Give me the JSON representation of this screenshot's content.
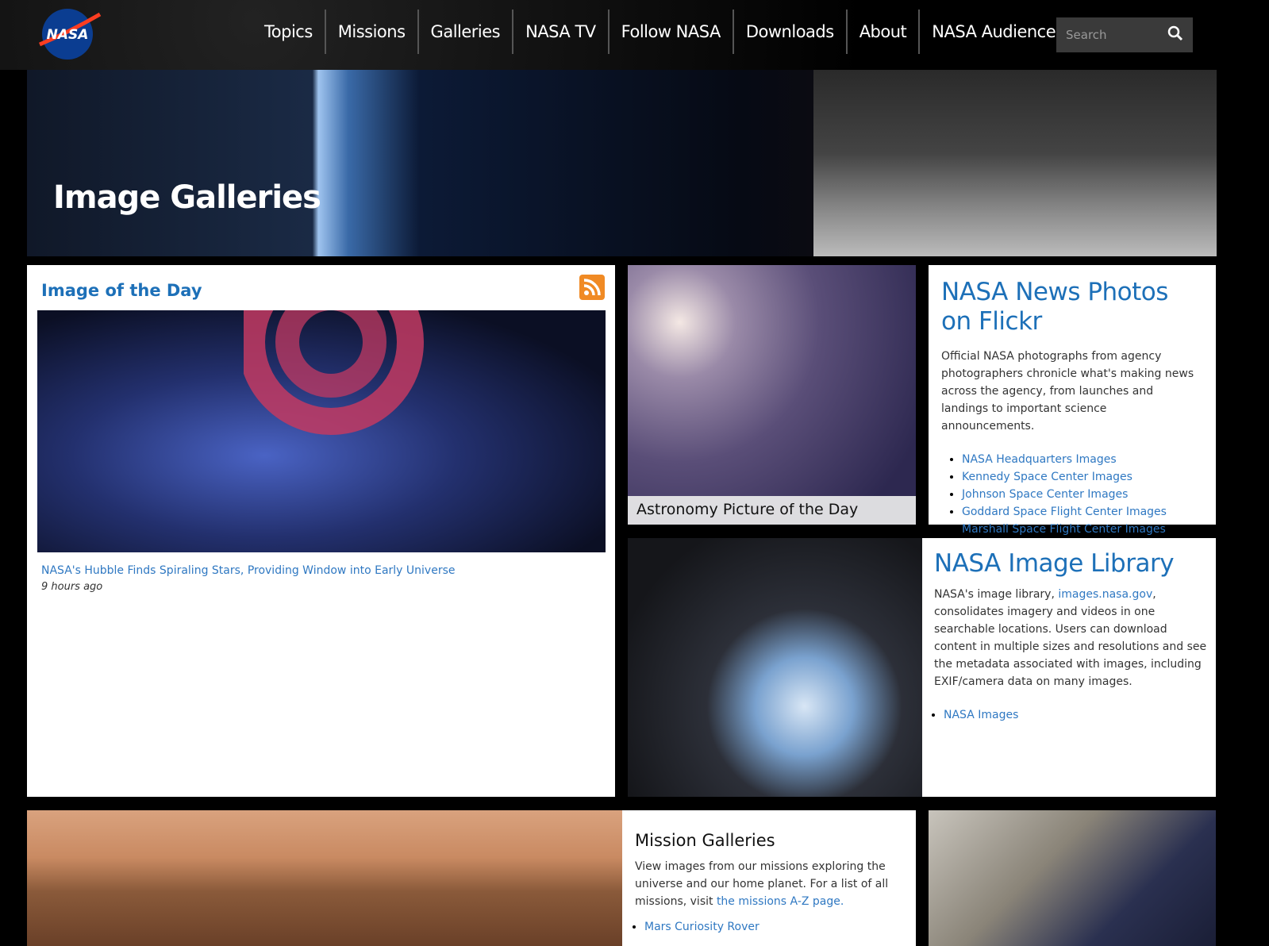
{
  "header": {
    "logo_text": "NASA",
    "nav": [
      "Topics",
      "Missions",
      "Galleries",
      "NASA TV",
      "Follow NASA",
      "Downloads",
      "About",
      "NASA Audiences"
    ],
    "search_placeholder": "Search"
  },
  "hero": {
    "title": "Image Galleries"
  },
  "iotd": {
    "title": "Image of the Day",
    "caption_link": "NASA's Hubble Finds Spiraling Stars, Providing Window into Early Universe",
    "time": "9 hours ago"
  },
  "apod": {
    "label": "Astronomy Picture of the Day"
  },
  "flickr": {
    "title": "NASA News Photos on Flickr",
    "description": "Official NASA photographs from agency photographers chronicle what's making news across the agency, from launches and landings to important science announcements.",
    "links": [
      "NASA Headquarters Images",
      "Kennedy Space Center Images",
      "Johnson Space Center Images",
      "Goddard Space Flight Center Images",
      "Marshall Space Flight Center Images"
    ]
  },
  "library": {
    "title": "NASA Image Library",
    "desc_before": "NASA's image library, ",
    "desc_link": "images.nasa.gov",
    "desc_after": ", consolidates imagery and videos in one searchable locations. Users can download content in multiple sizes and resolutions and see the metadata associated with images, including EXIF/camera data on many images.",
    "links": [
      "NASA Images"
    ]
  },
  "missions": {
    "title": "Mission Galleries",
    "desc": "View images from our missions exploring the universe and our home planet. For a list of all missions, visit ",
    "desc_link": "the missions A-Z page.",
    "links": [
      "Mars Curiosity Rover"
    ]
  },
  "colors": {
    "link": "#2f78c2",
    "rss": "#f08a24"
  }
}
